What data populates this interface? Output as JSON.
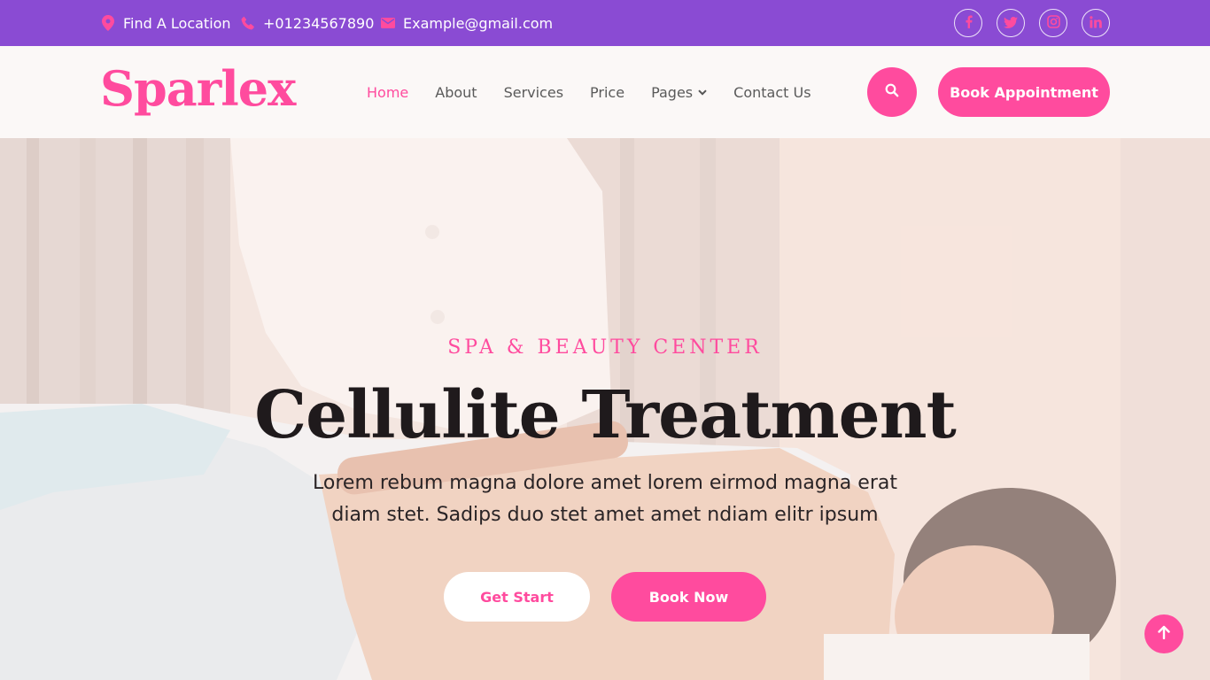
{
  "colors": {
    "accent": "#ff4b9e",
    "topbar": "#8a4bd3",
    "nav_bg": "#fbf8f7"
  },
  "topbar": {
    "location": {
      "icon": "map-marker-icon",
      "text": "Find A Location"
    },
    "phone": {
      "icon": "phone-icon",
      "text": "+01234567890"
    },
    "email": {
      "icon": "envelope-icon",
      "text": "Example@gmail.com"
    },
    "social": [
      "facebook-icon",
      "twitter-icon",
      "instagram-icon",
      "linkedin-icon"
    ]
  },
  "navbar": {
    "logo": "Sparlex",
    "menu": {
      "home": "Home",
      "about": "About",
      "services": "Services",
      "price": "Price",
      "pages": "Pages",
      "contact": "Contact Us"
    },
    "search_icon": "search-icon",
    "book_label": "Book Appointment"
  },
  "hero": {
    "kicker": "SPA & BEAUTY CENTER",
    "title": "Cellulite Treatment",
    "subtitle": "Lorem rebum magna dolore amet lorem eirmod magna erat diam stet. Sadips duo stet amet amet ndiam elitr ipsum",
    "start_label": "Get Start",
    "book_label": "Book Now"
  },
  "back_to_top_icon": "arrow-up-icon"
}
